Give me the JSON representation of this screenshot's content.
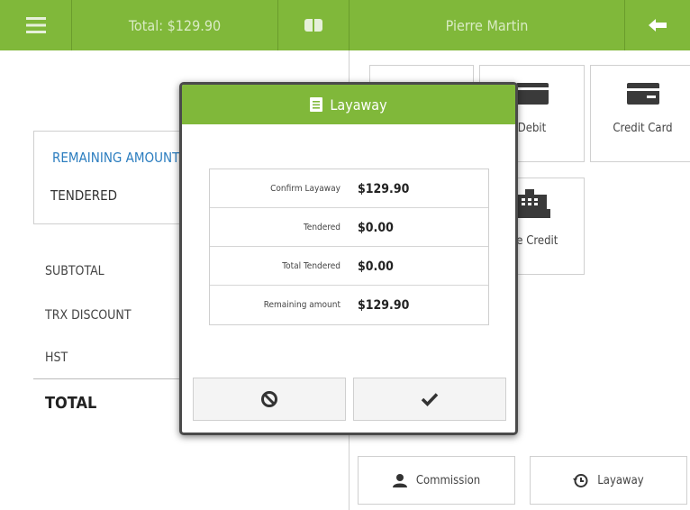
{
  "header": {
    "menu_icon": "hamburger-menu-icon",
    "total": "Total: $129.90",
    "card_icon": "card-icon",
    "customer": "Pierre Martin",
    "back_icon": "arrow-left-icon"
  },
  "left": {
    "remaining_label": "REMAINING AMOUNT",
    "tendered_label": "TENDERED",
    "subtotal": "SUBTOTAL",
    "trx_discount": "TRX DISCOUNT",
    "hst": "HST",
    "total": "TOTAL"
  },
  "tiles": {
    "debit": "Debit",
    "credit_card": "Credit Card",
    "store_credit": "ore Credit"
  },
  "bottom": {
    "commission": "Commission",
    "layaway": "Layaway"
  },
  "modal": {
    "title": "Layaway",
    "rows": [
      {
        "label": "Confirm Layaway",
        "value": "$129.90"
      },
      {
        "label": "Tendered",
        "value": "$0.00"
      },
      {
        "label": "Total Tendered",
        "value": "$0.00"
      },
      {
        "label": "Remaining amount",
        "value": "$129.90"
      }
    ],
    "cancel_icon": "ban-icon",
    "confirm_icon": "checkmark-icon"
  },
  "colors": {
    "brand_green": "#80b83a",
    "link_blue": "#2b7dbf"
  }
}
